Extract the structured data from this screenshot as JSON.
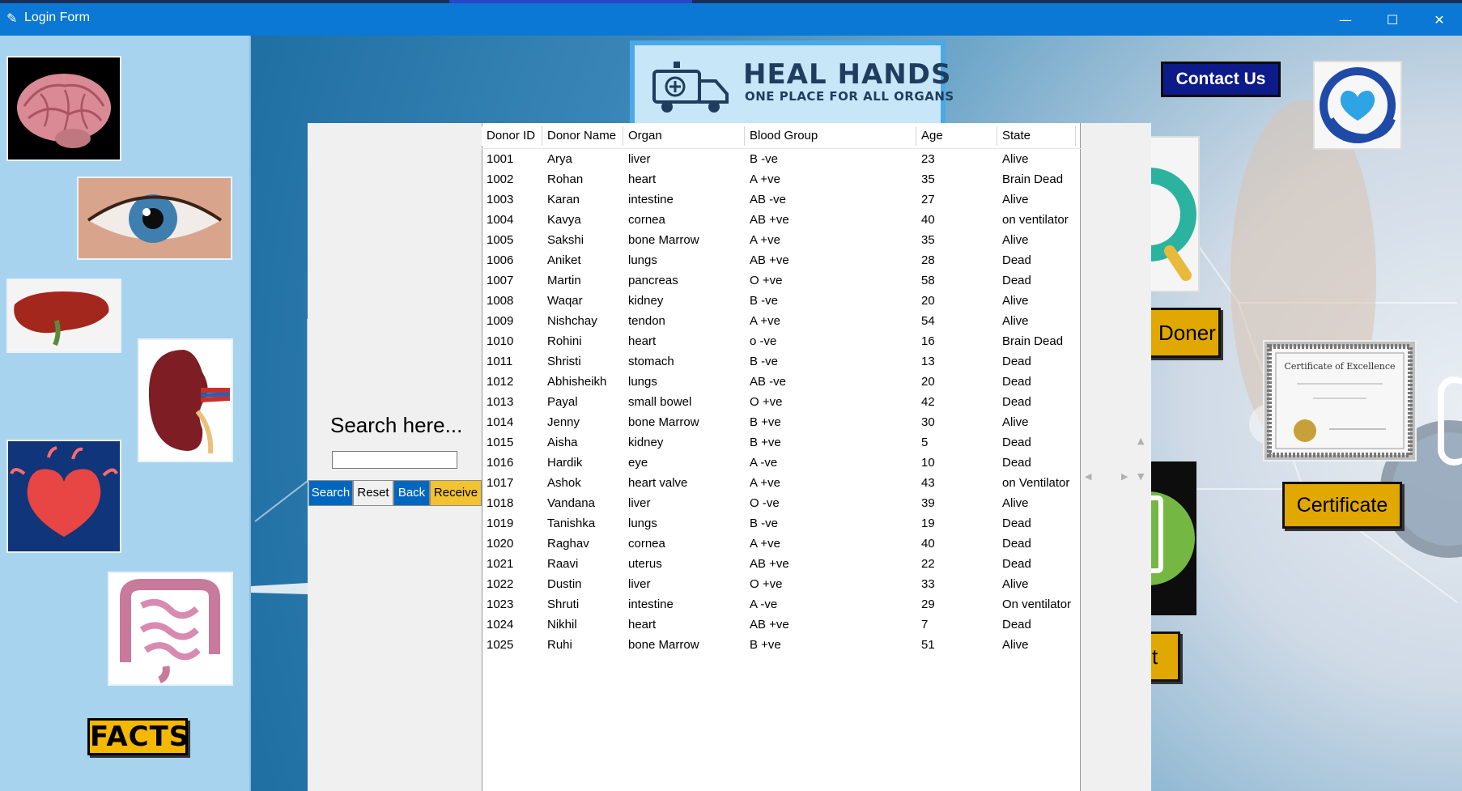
{
  "window": {
    "title": "Login Form",
    "controls": {
      "minimize": "—",
      "maximize": "☐",
      "close": "✕"
    }
  },
  "logo": {
    "title": "HEAL HANDS",
    "subtitle": "ONE PLACE FOR ALL ORGANS"
  },
  "left_panel": {
    "organs": [
      "brain",
      "eye",
      "liver",
      "kidney",
      "heart",
      "intestine"
    ],
    "facts_label": "FACTS"
  },
  "search": {
    "label": "Search here...",
    "input_value": "",
    "buttons": {
      "search": "Search",
      "reset": "Reset",
      "back": "Back",
      "receive": "Receive"
    }
  },
  "header_buttons": {
    "contact": "Contact Us"
  },
  "right_panel": {
    "doner": "Doner",
    "certificate": "Certificate",
    "partial": "t"
  },
  "colors": {
    "titlebar": "#0a78d4",
    "left_panel": "#a7d3ef",
    "blue_button": "#0067c0",
    "gold_button": "#e0a800",
    "contact_button": "#0d1a8a"
  },
  "table": {
    "columns": [
      "Donor ID",
      "Donor Name",
      "Organ",
      "Blood Group",
      "Age",
      "State"
    ],
    "rows": [
      [
        "1001",
        "Arya",
        "liver",
        "B -ve",
        "23",
        "Alive"
      ],
      [
        "1002",
        "Rohan",
        "heart",
        "A +ve",
        "35",
        "Brain Dead"
      ],
      [
        "1003",
        "Karan",
        "intestine",
        "AB -ve",
        "27",
        "Alive"
      ],
      [
        "1004",
        "Kavya",
        "cornea",
        "AB +ve",
        "40",
        "on ventilator"
      ],
      [
        "1005",
        "Sakshi",
        "bone Marrow",
        "A +ve",
        "35",
        "Alive"
      ],
      [
        "1006",
        "Aniket",
        "lungs",
        "AB +ve",
        "28",
        "Dead"
      ],
      [
        "1007",
        "Martin",
        "pancreas",
        "O +ve",
        "58",
        "Dead"
      ],
      [
        "1008",
        "Waqar",
        "kidney",
        "B -ve",
        "20",
        "Alive"
      ],
      [
        "1009",
        "Nishchay",
        "tendon",
        "A +ve",
        "54",
        "Alive"
      ],
      [
        "1010",
        "Rohini",
        "heart",
        "o -ve",
        "16",
        "Brain Dead"
      ],
      [
        "1011",
        "Shristi",
        "stomach",
        "B -ve",
        "13",
        "Dead"
      ],
      [
        "1012",
        "Abhisheikh",
        "lungs",
        "AB -ve",
        "20",
        "Dead"
      ],
      [
        "1013",
        "Payal",
        "small bowel",
        "O +ve",
        "42",
        "Dead"
      ],
      [
        "1014",
        "Jenny",
        "bone Marrow",
        "B +ve",
        "30",
        "Alive"
      ],
      [
        "1015",
        "Aisha",
        "kidney",
        "B +ve",
        "5",
        "Dead"
      ],
      [
        "1016",
        "Hardik",
        "eye",
        "A -ve",
        "10",
        "Dead"
      ],
      [
        "1017",
        "Ashok",
        "heart valve",
        "A +ve",
        "43",
        "on Ventilator"
      ],
      [
        "1018",
        "Vandana",
        "liver",
        "O -ve",
        "39",
        "Alive"
      ],
      [
        "1019",
        "Tanishka",
        "lungs",
        "B -ve",
        "19",
        "Dead"
      ],
      [
        "1020",
        "Raghav",
        "cornea",
        "A +ve",
        "40",
        "Dead"
      ],
      [
        "1021",
        "Raavi",
        "uterus",
        "AB +ve",
        "22",
        "Dead"
      ],
      [
        "1022",
        "Dustin",
        "liver",
        "O +ve",
        "33",
        "Alive"
      ],
      [
        "1023",
        "Shruti",
        "intestine",
        "A -ve",
        "29",
        "On ventilator"
      ],
      [
        "1024",
        "Nikhil",
        "heart",
        "AB +ve",
        "7",
        "Dead"
      ],
      [
        "1025",
        "Ruhi",
        "bone Marrow",
        "B +ve",
        "51",
        "Alive"
      ]
    ]
  }
}
